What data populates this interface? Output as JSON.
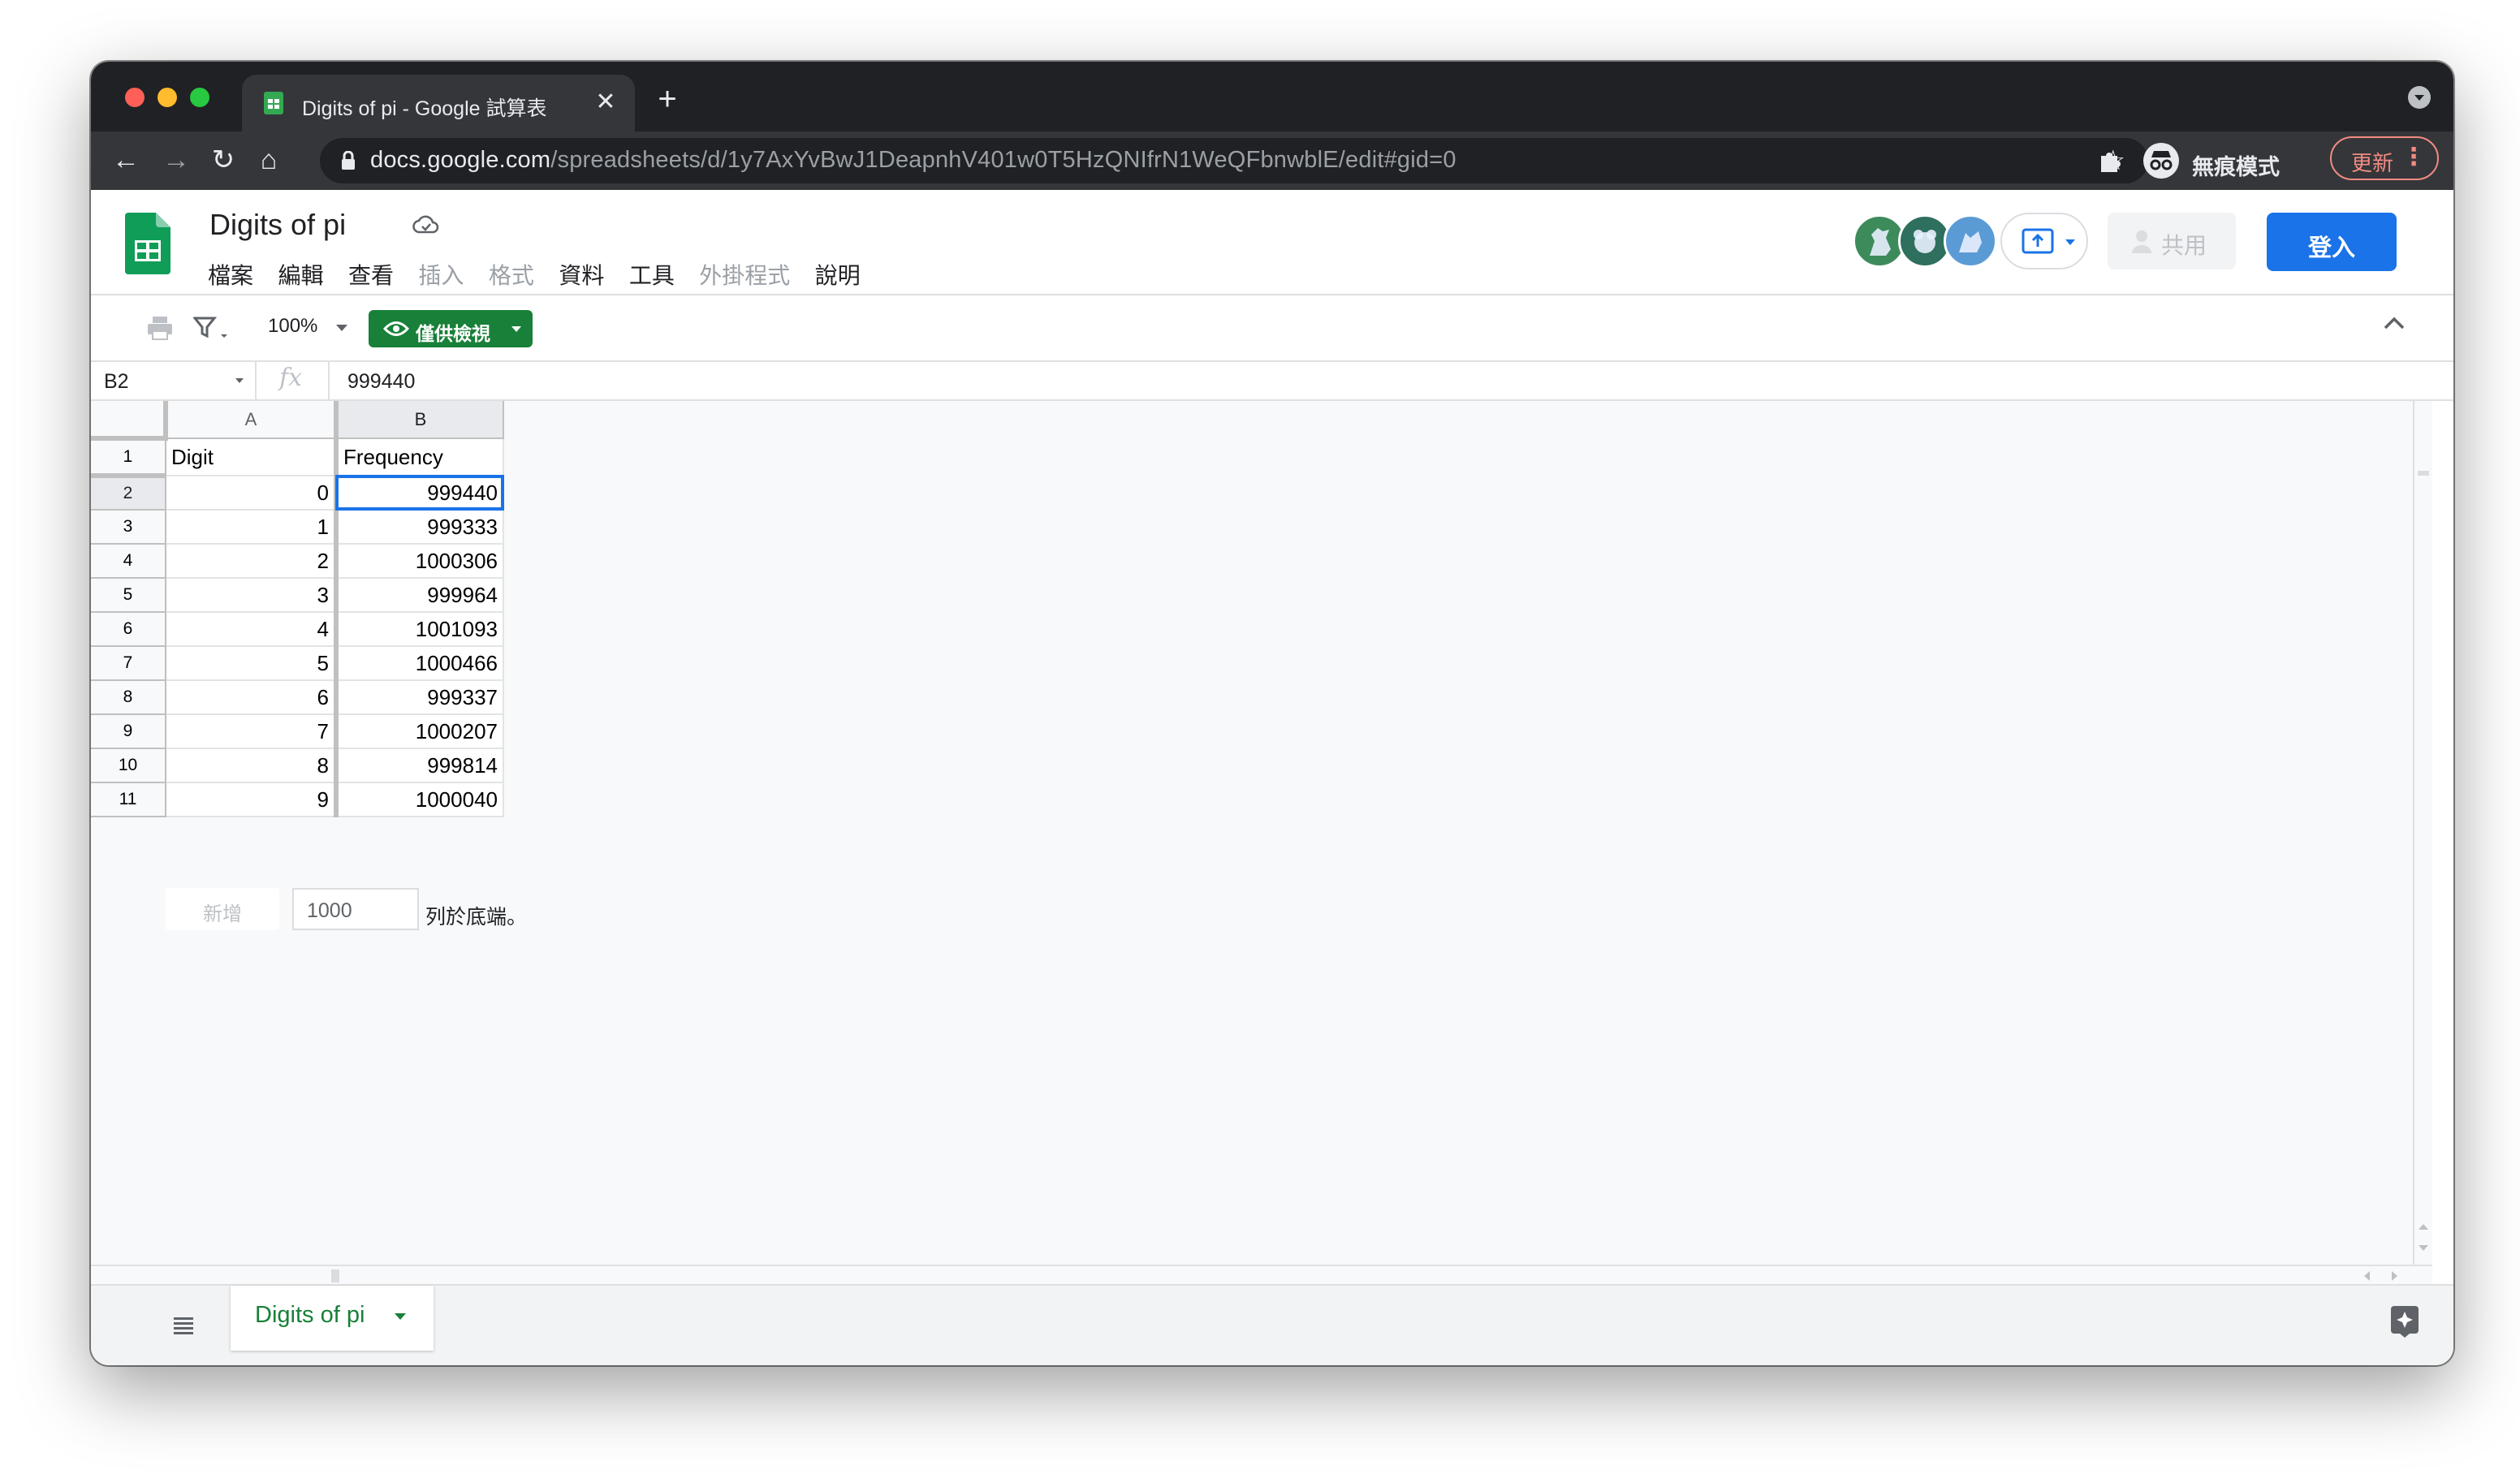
{
  "browser": {
    "tab_title": "Digits of pi - Google 試算表",
    "url_host": "docs.google.com",
    "url_path": "/spreadsheets/d/1y7AxYvBwJ1DeapnhV401w0T5HzQNIfrN1WeQFbnwblE/edit#gid=0",
    "profile_label": "無痕模式",
    "update_label": "更新"
  },
  "doc": {
    "title": "Digits of pi",
    "menu": [
      {
        "label": "檔案",
        "enabled": true
      },
      {
        "label": "編輯",
        "enabled": true
      },
      {
        "label": "查看",
        "enabled": true
      },
      {
        "label": "插入",
        "enabled": false
      },
      {
        "label": "格式",
        "enabled": false
      },
      {
        "label": "資料",
        "enabled": true
      },
      {
        "label": "工具",
        "enabled": true
      },
      {
        "label": "外掛程式",
        "enabled": false
      },
      {
        "label": "說明",
        "enabled": true
      }
    ],
    "share_label": "共用",
    "signin_label": "登入"
  },
  "toolbar": {
    "zoom": "100%",
    "view_only_label": "僅供檢視"
  },
  "formula_bar": {
    "cell_ref": "B2",
    "value": "999440"
  },
  "grid": {
    "columns": [
      "A",
      "B"
    ],
    "rows": [
      {
        "n": "1",
        "a": "Digit",
        "b": "Frequency"
      },
      {
        "n": "2",
        "a": "0",
        "b": "999440"
      },
      {
        "n": "3",
        "a": "1",
        "b": "999333"
      },
      {
        "n": "4",
        "a": "2",
        "b": "1000306"
      },
      {
        "n": "5",
        "a": "3",
        "b": "999964"
      },
      {
        "n": "6",
        "a": "4",
        "b": "1001093"
      },
      {
        "n": "7",
        "a": "5",
        "b": "1000466"
      },
      {
        "n": "8",
        "a": "6",
        "b": "999337"
      },
      {
        "n": "9",
        "a": "7",
        "b": "1000207"
      },
      {
        "n": "10",
        "a": "8",
        "b": "999814"
      },
      {
        "n": "11",
        "a": "9",
        "b": "1000040"
      }
    ],
    "selected_cell": "B2"
  },
  "add_rows": {
    "button_label": "新增",
    "count": "1000",
    "suffix": "列於底端。"
  },
  "sheets": [
    {
      "label": "Digits of pi",
      "active": true
    }
  ],
  "colors": {
    "sheets_green": "#188038",
    "signin_blue": "#1a73e8",
    "selection_blue": "#1a73e8"
  }
}
